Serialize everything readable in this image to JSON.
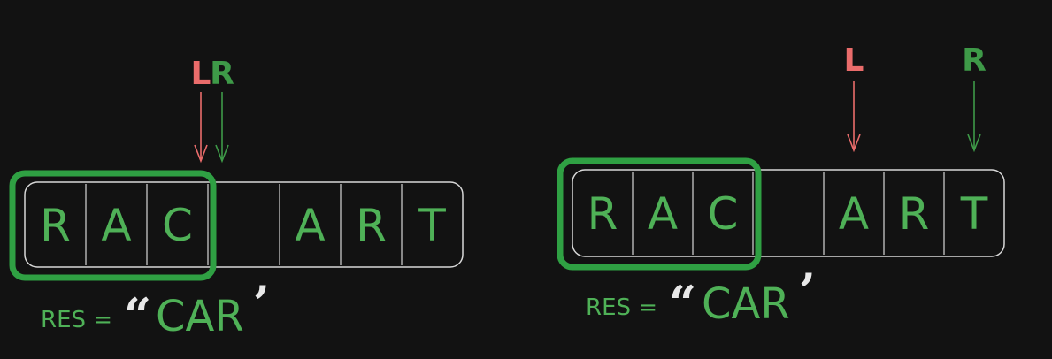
{
  "colors": {
    "background": "#121212",
    "green": "#4fb157",
    "pointer_left": "#ea6c6b",
    "pointer_right": "#3e9a48",
    "border": "#d8d8d8",
    "highlight": "#2fa043",
    "quote": "#e8e8e8"
  },
  "panels": [
    {
      "cells": [
        "R",
        "A",
        "C",
        "",
        "A",
        "R",
        "T"
      ],
      "left_pointer": {
        "label": "L",
        "index": 3
      },
      "right_pointer": {
        "label": "R",
        "index": 3
      },
      "window": {
        "start": 0,
        "end": 2
      },
      "result": {
        "label": "RES =",
        "open_quote": "“",
        "value": "CAR",
        "close_quote": "’"
      }
    },
    {
      "cells": [
        "R",
        "A",
        "C",
        "",
        "A",
        "R",
        "T"
      ],
      "left_pointer": {
        "label": "L",
        "index": 4
      },
      "right_pointer": {
        "label": "R",
        "index": 6
      },
      "window": {
        "start": 0,
        "end": 2
      },
      "result": {
        "label": "RES =",
        "open_quote": "“",
        "value": "CAR",
        "close_quote": "’"
      }
    }
  ]
}
